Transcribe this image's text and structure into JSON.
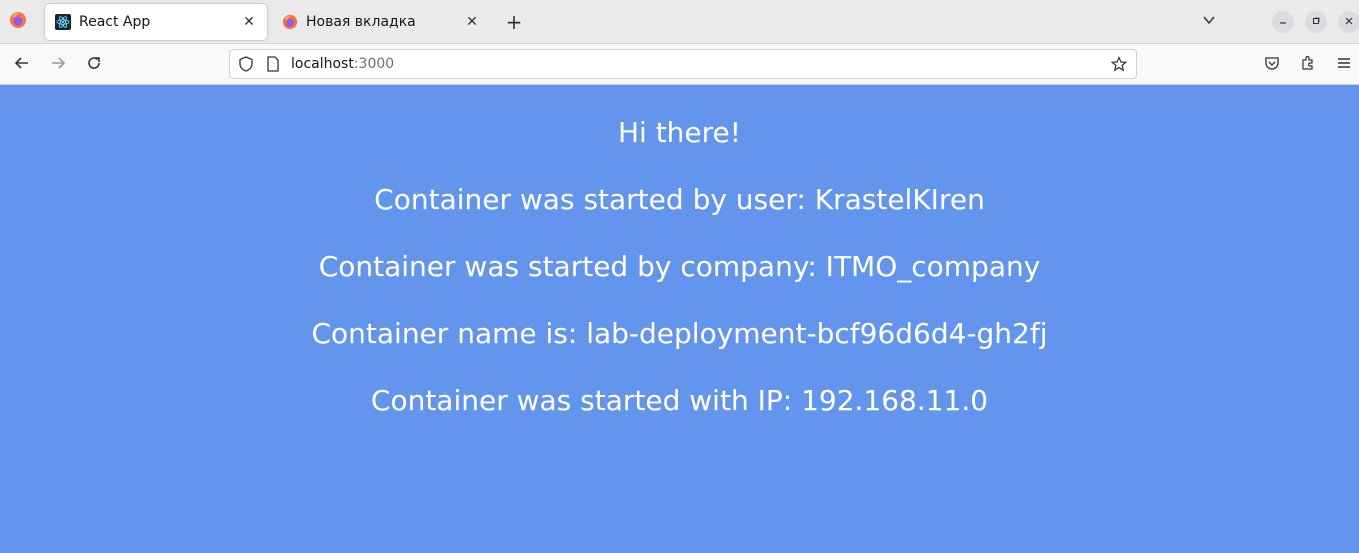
{
  "browser": {
    "tabs": [
      {
        "title": "React App",
        "favicon": "react-icon",
        "active": true
      },
      {
        "title": "Новая вкладка",
        "favicon": "firefox-icon",
        "active": false
      }
    ],
    "url_host": "localhost",
    "url_port": ":3000"
  },
  "page": {
    "greeting": "Hi there!",
    "user_line": "Container was started by user: KrastelKIren",
    "company_line": "Container was started by company: ITMO_company",
    "name_line": "Container name is: lab-deployment-bcf96d6d4-gh2fj",
    "ip_line": "Container was started with IP: 192.168.11.0"
  },
  "colors": {
    "page_background": "#6495ed",
    "text": "#ffffff"
  }
}
